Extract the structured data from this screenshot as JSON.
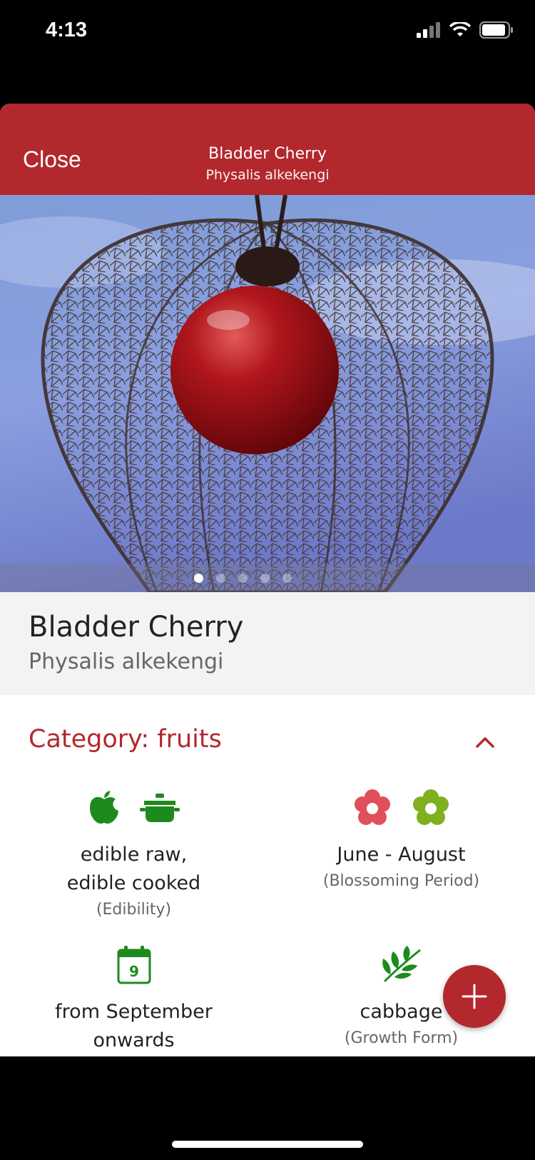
{
  "status_bar": {
    "time": "4:13"
  },
  "header": {
    "close_label": "Close",
    "title": "Bladder Cherry",
    "subtitle": "Physalis alkekengi"
  },
  "gallery": {
    "page_count": 5,
    "current_page": 1
  },
  "plant": {
    "common_name": "Bladder Cherry",
    "latin_name": "Physalis alkekengi"
  },
  "category": {
    "label": "Category: fruits"
  },
  "attributes": {
    "edibility": {
      "value_line1": "edible raw,",
      "value_line2": "edible cooked",
      "caption": "(Edibility)",
      "icons": [
        "apple-icon",
        "cooking-pot-icon"
      ]
    },
    "blossom": {
      "value": "June - August",
      "caption": "(Blossoming Period)",
      "icons": [
        "flower-pink-icon",
        "flower-green-icon"
      ]
    },
    "harvest": {
      "value_line1": "from September",
      "value_line2": "onwards",
      "icon": "calendar-icon",
      "calendar_day": "9"
    },
    "growth": {
      "value": "cabbage",
      "caption": "(Growth Form)",
      "icon": "leaf-branch-icon"
    }
  },
  "colors": {
    "accent": "#b3282d",
    "icon_green": "#1e8a1e"
  }
}
